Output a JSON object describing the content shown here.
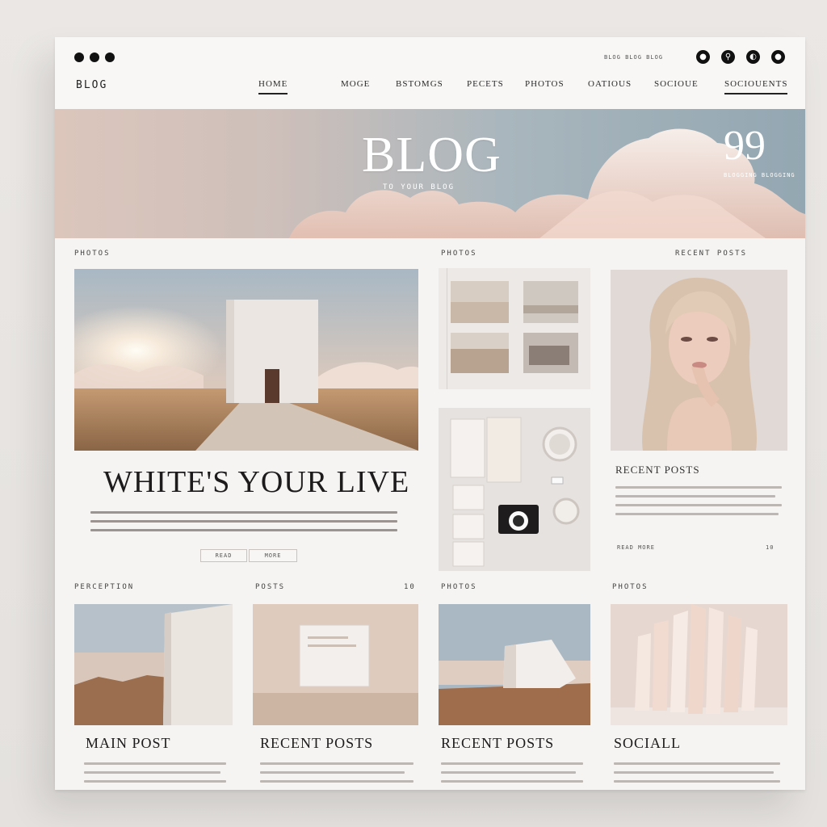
{
  "window": {
    "controls": [
      "close",
      "minimize",
      "maximize"
    ]
  },
  "topbar": {
    "info_text": "BLOG BLOG BLOG",
    "icons": [
      {
        "name": "user-icon",
        "glyph": "●"
      },
      {
        "name": "search-icon",
        "glyph": "⚲"
      },
      {
        "name": "share-icon",
        "glyph": "◐"
      },
      {
        "name": "menu-icon",
        "glyph": "●"
      }
    ]
  },
  "brand": "BLOG",
  "nav": {
    "items": [
      {
        "label": "HOME",
        "active": true
      },
      {
        "label": "MOGE",
        "active": false
      },
      {
        "label": "BSTOMGS",
        "active": false
      },
      {
        "label": "PECETS",
        "active": false
      },
      {
        "label": "PHOTOS",
        "active": false
      },
      {
        "label": "OATIOUS",
        "active": false
      },
      {
        "label": "SOCIOUE",
        "active": false
      },
      {
        "label": "SOCIOUENTS",
        "active": false
      }
    ]
  },
  "hero": {
    "title": "BLOG",
    "subtitle": "TO YOUR BLOG",
    "number": "99",
    "number_caption": "BLOGGING BLOGGING"
  },
  "sections": {
    "label_left": "PHOTOS",
    "label_middle": "PHOTOS",
    "label_right": "RECENT POSTS",
    "label_bottom_1": "PERCEPTION",
    "label_bottom_2": "POSTS",
    "label_bottom_2_num": "10",
    "label_bottom_3": "PHOTOS",
    "label_bottom_4": "PHOTOS"
  },
  "feature": {
    "title": "WHITE'S YOUR LIVE",
    "badge": "MORE",
    "btn_left": "READ",
    "btn_right": "MORE"
  },
  "sidebar": {
    "title": "RECENT POSTS",
    "meta_left": "READ MORE",
    "meta_right": "10"
  },
  "bottom_cards": [
    {
      "title": "MAIN POST"
    },
    {
      "title": "RECENT POSTS"
    },
    {
      "title": "RECENT POSTS"
    },
    {
      "title": "SOCIALL"
    }
  ]
}
